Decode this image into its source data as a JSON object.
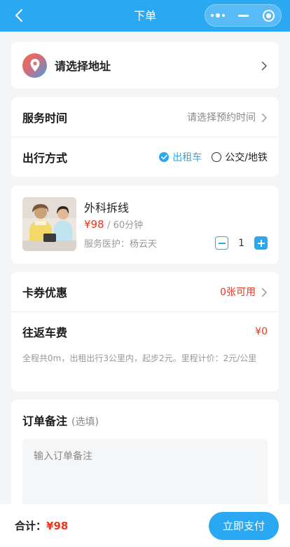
{
  "nav": {
    "title": "下单",
    "back_icon": "chevron-left-icon",
    "capsule_icons": [
      "more-dots-icon",
      "minimize-icon",
      "close-target-icon"
    ]
  },
  "address": {
    "placeholder": "请选择地址",
    "icon": "location-pin-icon"
  },
  "service_time": {
    "label": "服务时间",
    "placeholder": "请选择预约时间"
  },
  "transport": {
    "label": "出行方式",
    "options": [
      {
        "label": "出租车",
        "selected": true
      },
      {
        "label": "公交/地铁",
        "selected": false
      }
    ]
  },
  "product": {
    "name": "外科拆线",
    "price": "¥98",
    "duration": "/ 60分钟",
    "doctor": "服务医护：杨云天",
    "quantity": "1"
  },
  "coupon": {
    "label": "卡券优惠",
    "value": "0张可用"
  },
  "fare": {
    "label": "往返车费",
    "value": "¥0",
    "note": "全程共0m，出租出行3公里内，起步2元。里程计价：2元/公里"
  },
  "remark": {
    "label": "订单备注",
    "optional": "(选填)",
    "placeholder": "输入订单备注"
  },
  "footer": {
    "total_label": "合计：",
    "total_amount": "¥98",
    "pay_label": "立即支付"
  },
  "colors": {
    "primary": "#2aa8f2",
    "price": "#f0331c"
  }
}
